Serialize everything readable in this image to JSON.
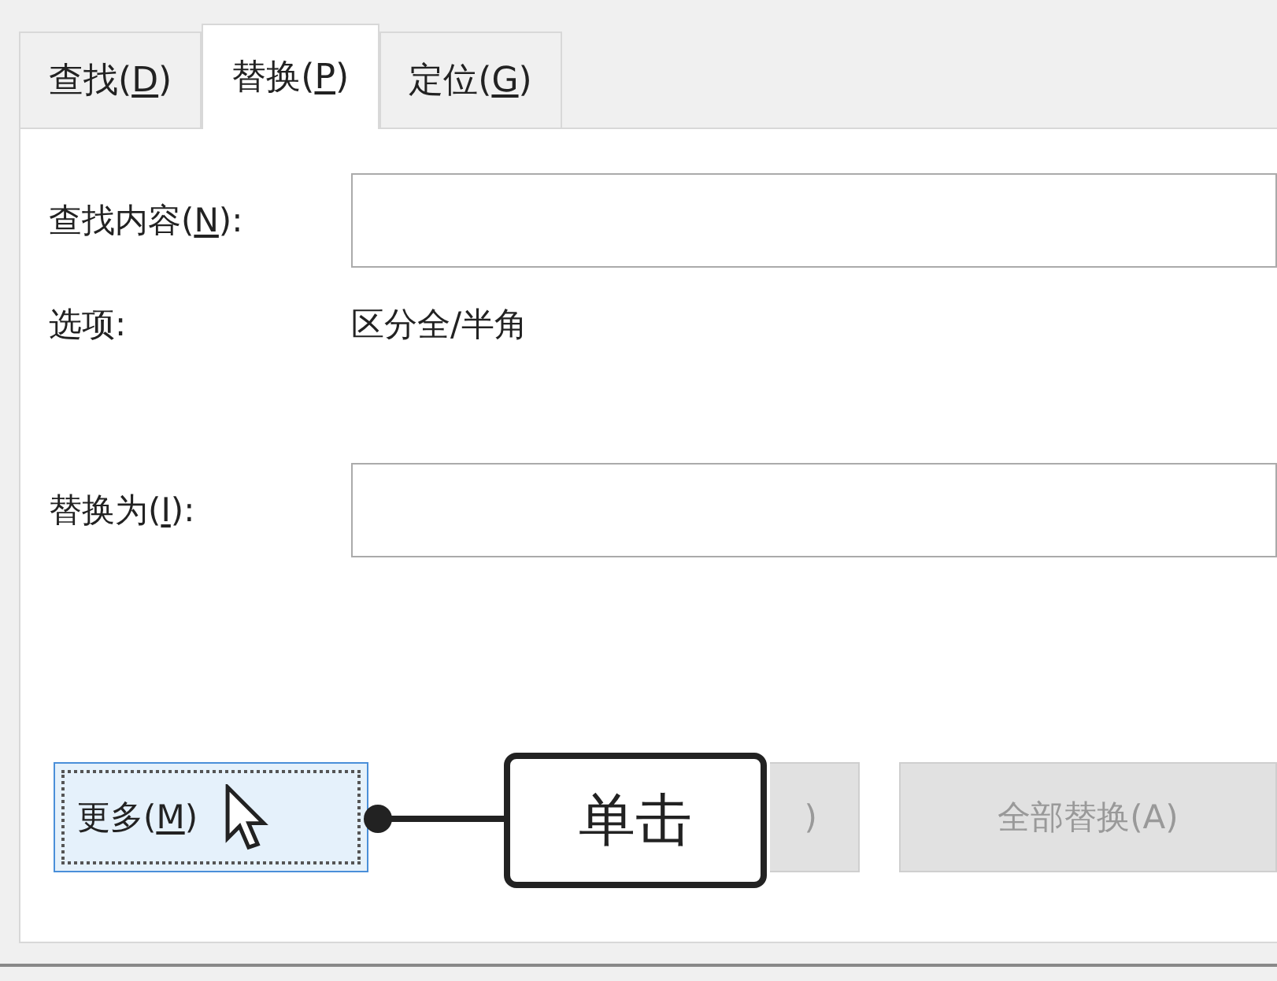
{
  "tabs": [
    {
      "label": {
        "before": "查找(",
        "key": "D",
        "after": ")"
      },
      "selected": false
    },
    {
      "label": {
        "before": "替换(",
        "key": "P",
        "after": ")"
      },
      "selected": true
    },
    {
      "label": {
        "before": "定位(",
        "key": "G",
        "after": ")"
      },
      "selected": false
    }
  ],
  "find": {
    "label": {
      "before": "查找内容(",
      "key": "N",
      "after": "):"
    }
  },
  "options": {
    "label": "选项:",
    "value": "区分全/半角"
  },
  "replace": {
    "label": {
      "before": "替换为(",
      "key": "I",
      "after": "):"
    }
  },
  "buttons": [
    {
      "label": {
        "before": "更多(",
        "key": "M",
        "after": ")"
      },
      "focused": true
    },
    {
      "label": {
        "after": ")"
      },
      "focused": false
    },
    {
      "label": {
        "before": "全部替换(A)"
      },
      "focused": false
    }
  ],
  "callout": {
    "text": "单击"
  }
}
